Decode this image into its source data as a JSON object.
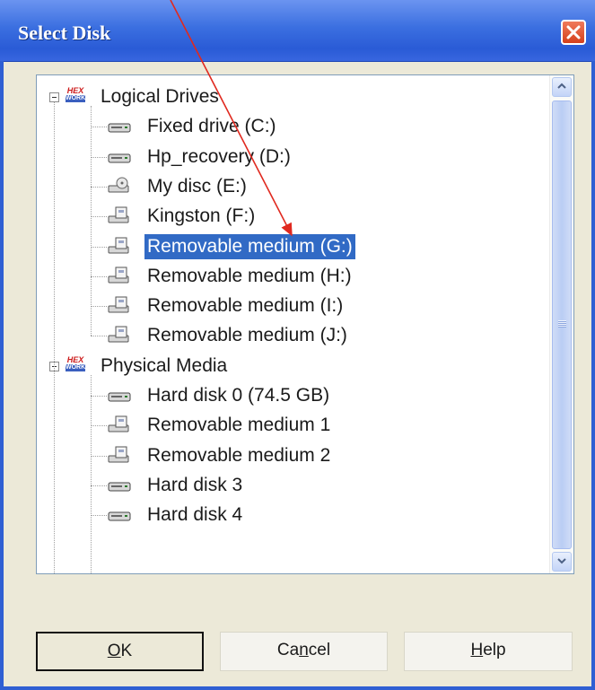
{
  "window": {
    "title": "Select Disk"
  },
  "tree": {
    "groups": [
      {
        "label": "Logical Drives",
        "icon": "hex-logo-icon",
        "items": [
          {
            "label": "Fixed drive (C:)",
            "icon": "hard-drive-icon",
            "selected": false
          },
          {
            "label": "Hp_recovery (D:)",
            "icon": "hard-drive-icon",
            "selected": false
          },
          {
            "label": "My disc (E:)",
            "icon": "optical-drive-icon",
            "selected": false
          },
          {
            "label": "Kingston (F:)",
            "icon": "removable-drive-icon",
            "selected": false
          },
          {
            "label": "Removable medium (G:)",
            "icon": "removable-drive-icon",
            "selected": true
          },
          {
            "label": "Removable medium (H:)",
            "icon": "removable-drive-icon",
            "selected": false
          },
          {
            "label": "Removable medium (I:)",
            "icon": "removable-drive-icon",
            "selected": false
          },
          {
            "label": "Removable medium (J:)",
            "icon": "removable-drive-icon",
            "selected": false
          }
        ]
      },
      {
        "label": "Physical Media",
        "icon": "hex-logo-icon",
        "items": [
          {
            "label": "Hard disk 0 (74.5 GB)",
            "icon": "hard-drive-icon",
            "selected": false
          },
          {
            "label": "Removable medium 1",
            "icon": "removable-drive-icon",
            "selected": false
          },
          {
            "label": "Removable medium 2",
            "icon": "removable-drive-icon",
            "selected": false
          },
          {
            "label": "Hard disk 3",
            "icon": "hard-drive-icon",
            "selected": false
          },
          {
            "label": "Hard disk 4",
            "icon": "hard-drive-icon",
            "selected": false
          }
        ]
      }
    ],
    "icon_logo_text": {
      "top": "HEX",
      "bottom": "WORKS"
    }
  },
  "buttons": {
    "ok": {
      "mnemonic": "O",
      "rest": "K"
    },
    "cancel": {
      "before": "Ca",
      "mnemonic": "n",
      "after": "cel"
    },
    "help": {
      "mnemonic": "H",
      "rest": "elp"
    }
  },
  "colors": {
    "titlebar": "#3b6fe0",
    "selection": "#316ac5",
    "annotation_arrow": "#e0291f",
    "dialog_bg": "#ece9d8"
  }
}
